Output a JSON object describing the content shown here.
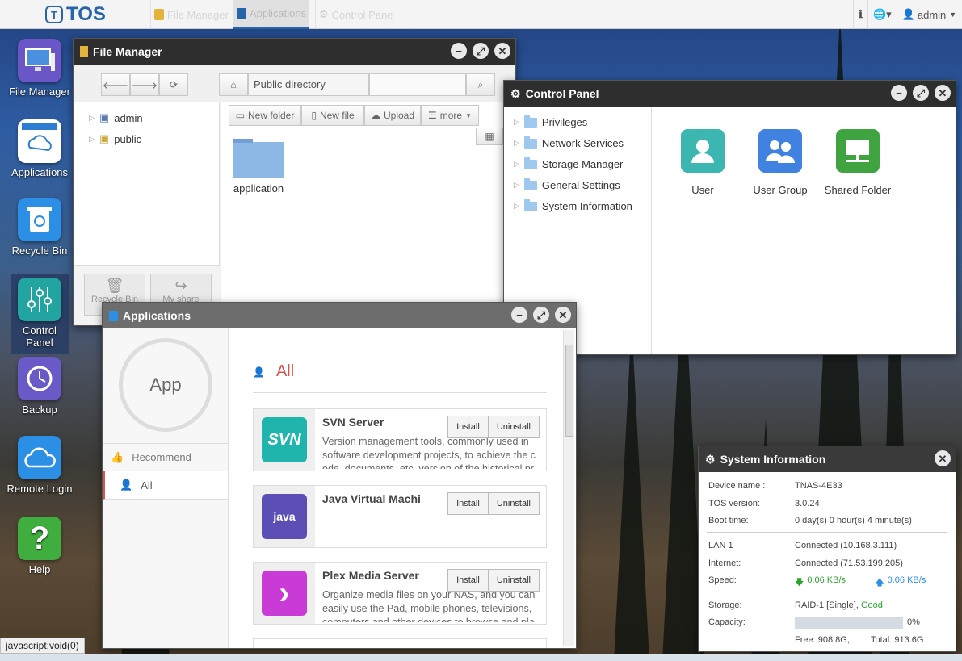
{
  "topbar": {
    "logo": "TOS",
    "tasks": [
      "File Manager",
      "Applications",
      "Control Pane"
    ],
    "user": "admin"
  },
  "desktop": {
    "icons": [
      {
        "label": "File Manager",
        "icon": "monitor-icon"
      },
      {
        "label": "Applications",
        "icon": "shopping-bag-cloud-icon"
      },
      {
        "label": "Recycle Bin",
        "icon": "recycle-bin-icon"
      },
      {
        "label": "Control Panel",
        "icon": "sliders-icon"
      },
      {
        "label": "Backup",
        "icon": "clock-icon"
      },
      {
        "label": "Remote Login",
        "icon": "cloud-icon"
      },
      {
        "label": "Help",
        "icon": "question-icon"
      }
    ],
    "status_url": "javascript:void(0)"
  },
  "file_manager": {
    "title": "File Manager",
    "path": "Public directory",
    "tree": [
      "admin",
      "public"
    ],
    "toolbar": {
      "new_folder": "New folder",
      "new_file": "New file",
      "upload": "Upload",
      "more": "more"
    },
    "items": [
      "application"
    ],
    "bottom": {
      "recycle": "Recycle Bin",
      "share": "My share"
    }
  },
  "control_panel": {
    "title": "Control Panel",
    "menu": [
      "Privileges",
      "Network Services",
      "Storage Manager",
      "General Settings",
      "System Information"
    ],
    "apps": [
      {
        "label": "User",
        "color": "#3bb6b0"
      },
      {
        "label": "User Group",
        "color": "#3f82e0"
      },
      {
        "label": "Shared Folder",
        "color": "#3fa33f"
      }
    ]
  },
  "applications": {
    "title": "Applications",
    "badge": "App",
    "side": [
      "Recommend",
      "All"
    ],
    "heading": "All",
    "install_label": "Install",
    "uninstall_label": "Uninstall",
    "apps": [
      {
        "name": "SVN Server",
        "logo": "SVN",
        "color": "#1fb5ad",
        "desc": "Version management tools, commonly used in software development projects, to achieve the c ode, documents, etc. version of the historical pr"
      },
      {
        "name": "Java Virtual Machi",
        "logo": "java",
        "color": "#5b4fb5",
        "desc": ""
      },
      {
        "name": "Plex Media Server",
        "logo": "›",
        "color": "#c93ad6",
        "desc": "Organize media files on your NAS, and you can easily use the Pad, mobile phones, televisions, computers and other devices to browse and pla"
      }
    ]
  },
  "system_info": {
    "title": "System Information",
    "rows": [
      {
        "k": "Device name :",
        "v": "TNAS-4E33"
      },
      {
        "k": "TOS version:",
        "v": "3.0.24"
      },
      {
        "k": "Boot time:",
        "v": "0 day(s) 0 hour(s) 4 minute(s)"
      },
      {
        "k": "LAN 1",
        "v": "Connected (10.168.3.111)"
      },
      {
        "k": "Internet:",
        "v": "Connected (71.53.199.205)"
      },
      {
        "k": "Speed:",
        "down": "0.06 KB/s",
        "up": "0.06 KB/s"
      },
      {
        "k": "Storage:",
        "v": "RAID-1 [Single],",
        "status": "Good"
      },
      {
        "k": "Capacity:",
        "percent": "0%",
        "used_fraction": 0.0
      },
      {
        "free": "Free: 908.8G,",
        "total": "Total: 913.6G"
      }
    ]
  }
}
